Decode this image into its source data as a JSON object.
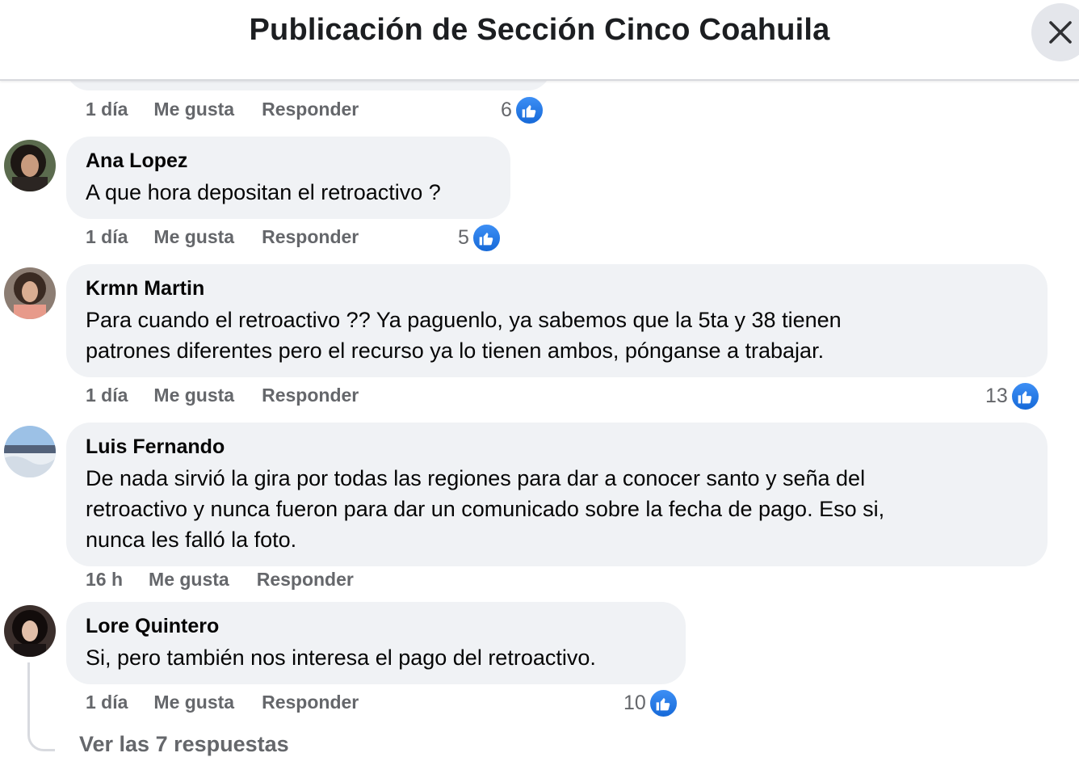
{
  "header": {
    "title": "Publicación de Sección Cinco Coahuila"
  },
  "action_labels": {
    "like": "Me gusta",
    "reply": "Responder"
  },
  "previous_comment": {
    "time": "1 día",
    "reactions": "6"
  },
  "comments": [
    {
      "author": "Ana Lopez",
      "lines": [
        "A que hora depositan el retroactivo ?"
      ],
      "time": "1 día",
      "reactions": "5"
    },
    {
      "author": "Krmn Martin",
      "lines": [
        "Para cuando el retroactivo ?? Ya paguenlo, ya sabemos que la 5ta y 38 tienen",
        "patrones diferentes pero el recurso ya lo tienen ambos, pónganse a trabajar."
      ],
      "time": "1 día",
      "reactions": "13"
    },
    {
      "author": "Luis Fernando",
      "lines": [
        "De nada sirvió la gira por todas las regiones para dar a conocer santo y seña del",
        "retroactivo y nunca fueron para dar un comunicado sobre la fecha de pago. Eso si,",
        "nunca les falló la foto."
      ],
      "time": "16 h",
      "reactions": ""
    },
    {
      "author": "Lore Quintero",
      "lines": [
        "Si, pero también nos interesa el pago del retroactivo."
      ],
      "time": "1 día",
      "reactions": "10"
    }
  ],
  "see_replies": "Ver las 7 respuestas",
  "colors": {
    "bubble": "#f0f2f5",
    "meta_text": "#65676b",
    "like_blue": "#1877f2"
  },
  "icons": {
    "close": "close-icon",
    "like": "like-thumb-icon"
  }
}
